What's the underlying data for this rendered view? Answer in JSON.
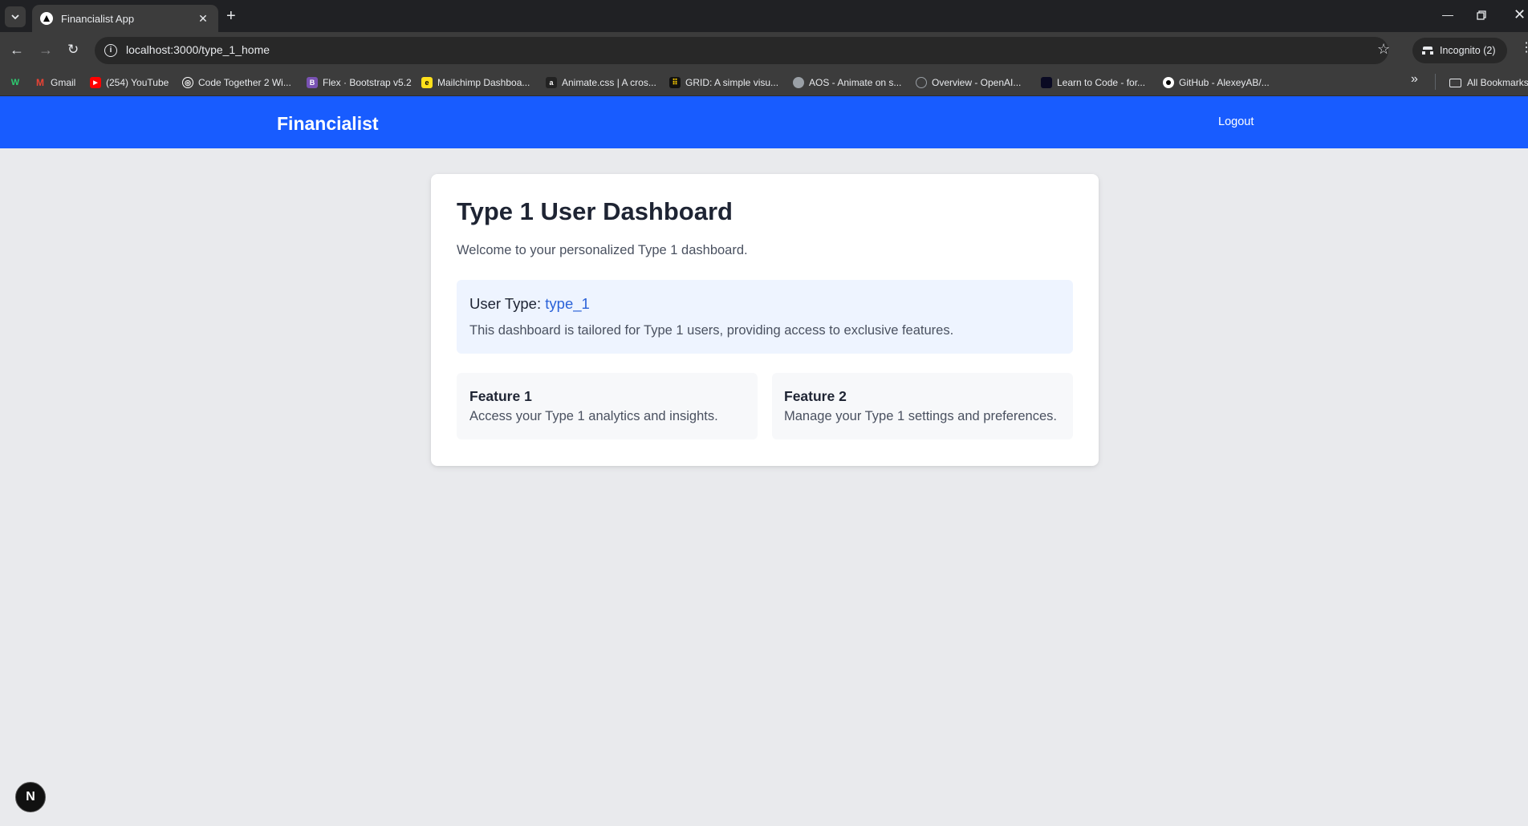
{
  "browser": {
    "tab_title": "Financialist App",
    "url": "localhost:3000/type_1_home",
    "incognito_label": "Incognito (2)",
    "bookmarks": [
      {
        "label": "Gmail",
        "icon": "gmail-icon",
        "color": "#ea4335"
      },
      {
        "label": "(254) YouTube",
        "icon": "youtube-icon",
        "color": "#ff0000"
      },
      {
        "label": "Code Together 2 Wi...",
        "icon": "codetogether-icon",
        "color": "#ffffff"
      },
      {
        "label": "Flex · Bootstrap v5.2",
        "icon": "bootstrap-icon",
        "color": "#7952b3"
      },
      {
        "label": "Mailchimp Dashboa...",
        "icon": "mailchimp-icon",
        "color": "#ffe01b"
      },
      {
        "label": "Animate.css | A cros...",
        "icon": "animate-icon",
        "color": "#222222"
      },
      {
        "label": "GRID: A simple visu...",
        "icon": "grid-icon",
        "color": "#111111"
      },
      {
        "label": "AOS - Animate on s...",
        "icon": "aos-icon",
        "color": "#9aa0a6"
      },
      {
        "label": "Overview - OpenAI...",
        "icon": "openai-icon",
        "color": "#202124"
      },
      {
        "label": "Learn to Code - for...",
        "icon": "freecodecamp-icon",
        "color": "#0a0a23"
      },
      {
        "label": "GitHub - AlexeyAB/...",
        "icon": "github-icon",
        "color": "#ffffff"
      }
    ],
    "all_bookmarks_label": "All Bookmarks"
  },
  "header": {
    "brand": "Financialist",
    "logout_label": "Logout",
    "color": "#185cff"
  },
  "dashboard": {
    "title": "Type 1 User Dashboard",
    "subtitle": "Welcome to your personalized Type 1 dashboard.",
    "user_type_label": "User Type: ",
    "user_type_value": "type_1",
    "info_text": "This dashboard is tailored for Type 1 users, providing access to exclusive features.",
    "features": [
      {
        "title": "Feature 1",
        "description": "Access your Type 1 analytics and insights."
      },
      {
        "title": "Feature 2",
        "description": "Manage your Type 1 settings and preferences."
      }
    ]
  },
  "dev_badge": "N"
}
